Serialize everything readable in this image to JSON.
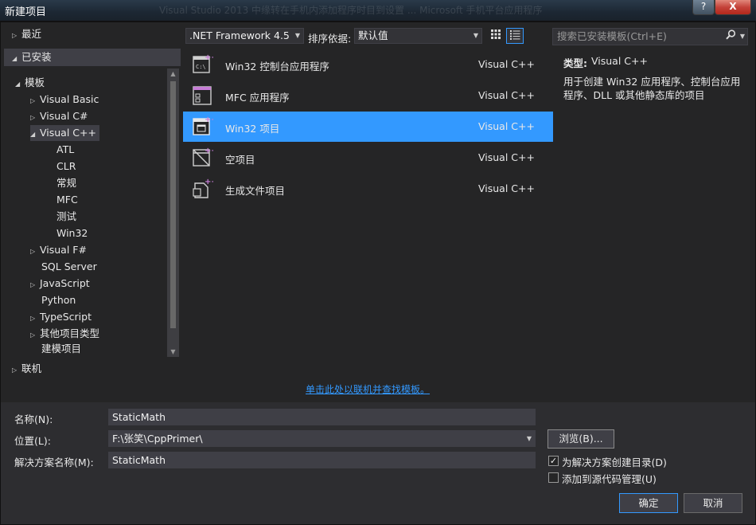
{
  "window": {
    "title": "新建项目",
    "ghost_text": "Visual Studio 2013 中缘转在手机内添加程序时目到设置 ... Microsoft 手机平台应用程序",
    "help_label": "?",
    "close_label": "X"
  },
  "tree": {
    "recent": "最近",
    "installed": "已安装",
    "templates": "模板",
    "items": [
      {
        "label": "Visual Basic"
      },
      {
        "label": "Visual C#"
      },
      {
        "label": "Visual C++"
      },
      {
        "label": "ATL"
      },
      {
        "label": "CLR"
      },
      {
        "label": "常规"
      },
      {
        "label": "MFC"
      },
      {
        "label": "测试"
      },
      {
        "label": "Win32"
      },
      {
        "label": "Visual F#"
      },
      {
        "label": "SQL Server"
      },
      {
        "label": "JavaScript"
      },
      {
        "label": "Python"
      },
      {
        "label": "TypeScript"
      },
      {
        "label": "其他项目类型"
      },
      {
        "label": "建模项目"
      }
    ],
    "online": "联机"
  },
  "toolbar": {
    "framework": ".NET Framework 4.5",
    "sort_label": "排序依据:",
    "sort_value": "默认值",
    "search_placeholder": "搜索已安装模板(Ctrl+E)"
  },
  "templates": [
    {
      "name": "Win32 控制台应用程序",
      "lang": "Visual C++"
    },
    {
      "name": "MFC 应用程序",
      "lang": "Visual C++"
    },
    {
      "name": "Win32 项目",
      "lang": "Visual C++"
    },
    {
      "name": "空项目",
      "lang": "Visual C++"
    },
    {
      "name": "生成文件项目",
      "lang": "Visual C++"
    }
  ],
  "description": {
    "type_key": "类型:",
    "type_value": "Visual C++",
    "text": "用于创建 Win32 应用程序、控制台应用程序、DLL 或其他静态库的项目"
  },
  "online_link": "单击此处以联机并查找模板。",
  "form": {
    "name_label": "名称(N):",
    "name_value": "StaticMath",
    "location_label": "位置(L):",
    "location_value": "F:\\张笑\\CppPrimer\\",
    "solution_label": "解决方案名称(M):",
    "solution_value": "StaticMath",
    "browse_label": "浏览(B)...",
    "create_dir_label": "为解决方案创建目录(D)",
    "create_dir_checked": true,
    "source_control_label": "添加到源代码管理(U)",
    "source_control_checked": false
  },
  "buttons": {
    "ok": "确定",
    "cancel": "取消"
  },
  "colors": {
    "selection": "#3399ff",
    "background": "#252526",
    "panel": "#2d2d30",
    "accent_icon": "#c77dd7"
  }
}
